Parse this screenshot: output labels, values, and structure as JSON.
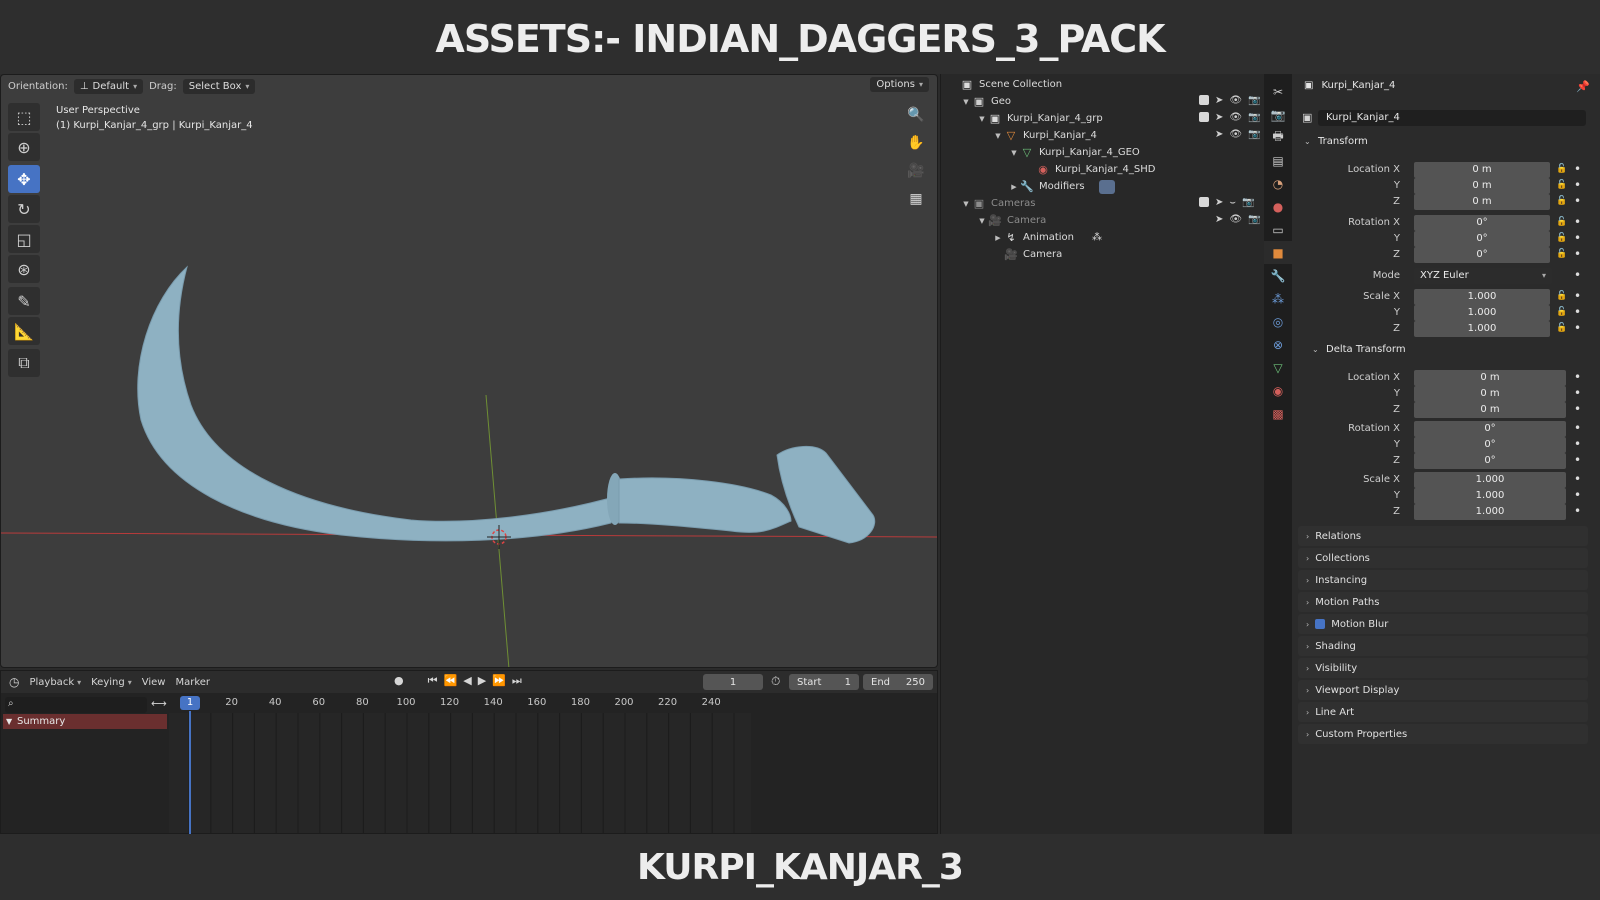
{
  "banner_top": "ASSETS:- INDIAN_DAGGERS_3_PACK",
  "banner_bottom": "KURPI_KANJAR_3",
  "viewport": {
    "orientation_label": "Orientation:",
    "orientation_value": "Default",
    "drag_label": "Drag:",
    "drag_value": "Select Box",
    "options_label": "Options",
    "info_line1": "User Perspective",
    "info_line2": "(1) Kurpi_Kanjar_4_grp | Kurpi_Kanjar_4"
  },
  "timeline": {
    "menus": [
      "Playback",
      "Keying",
      "View",
      "Marker"
    ],
    "current_frame": "1",
    "start_label": "Start",
    "start_value": "1",
    "end_label": "End",
    "end_value": "250",
    "cursor_frame": "1",
    "ruler_numbers": [
      "20",
      "40",
      "60",
      "80",
      "100",
      "120",
      "140",
      "160",
      "180",
      "200",
      "220",
      "240"
    ],
    "summary_label": "Summary"
  },
  "outliner": {
    "root": "Scene Collection",
    "rows": [
      {
        "label": "Geo"
      },
      {
        "label": "Kurpi_Kanjar_4_grp"
      },
      {
        "label": "Kurpi_Kanjar_4"
      },
      {
        "label": "Kurpi_Kanjar_4_GEO"
      },
      {
        "label": "Kurpi_Kanjar_4_SHD"
      },
      {
        "label": "Modifiers"
      },
      {
        "label": "Cameras"
      },
      {
        "label": "Camera"
      },
      {
        "label": "Animation"
      },
      {
        "label": "Camera"
      }
    ]
  },
  "properties": {
    "object_title": "Kurpi_Kanjar_4",
    "object_name_field": "Kurpi_Kanjar_4",
    "transform_title": "Transform",
    "location_x_label": "Location X",
    "y_label": "Y",
    "z_label": "Z",
    "rotation_x_label": "Rotation X",
    "mode_label": "Mode",
    "mode_value": "XYZ Euler",
    "scale_x_label": "Scale X",
    "loc_value": "0 m",
    "rot_value": "0°",
    "scale_value": "1.000",
    "delta_title": "Delta Transform",
    "collapsed_panels": [
      "Relations",
      "Collections",
      "Instancing",
      "Motion Paths",
      "Motion Blur",
      "Shading",
      "Visibility",
      "Viewport Display",
      "Line Art",
      "Custom Properties"
    ]
  },
  "colors": {
    "accent": "#4673c4",
    "blade": "#8eb1c2",
    "x_axis": "#b83b3b",
    "y_axis": "#7a9a3a"
  }
}
